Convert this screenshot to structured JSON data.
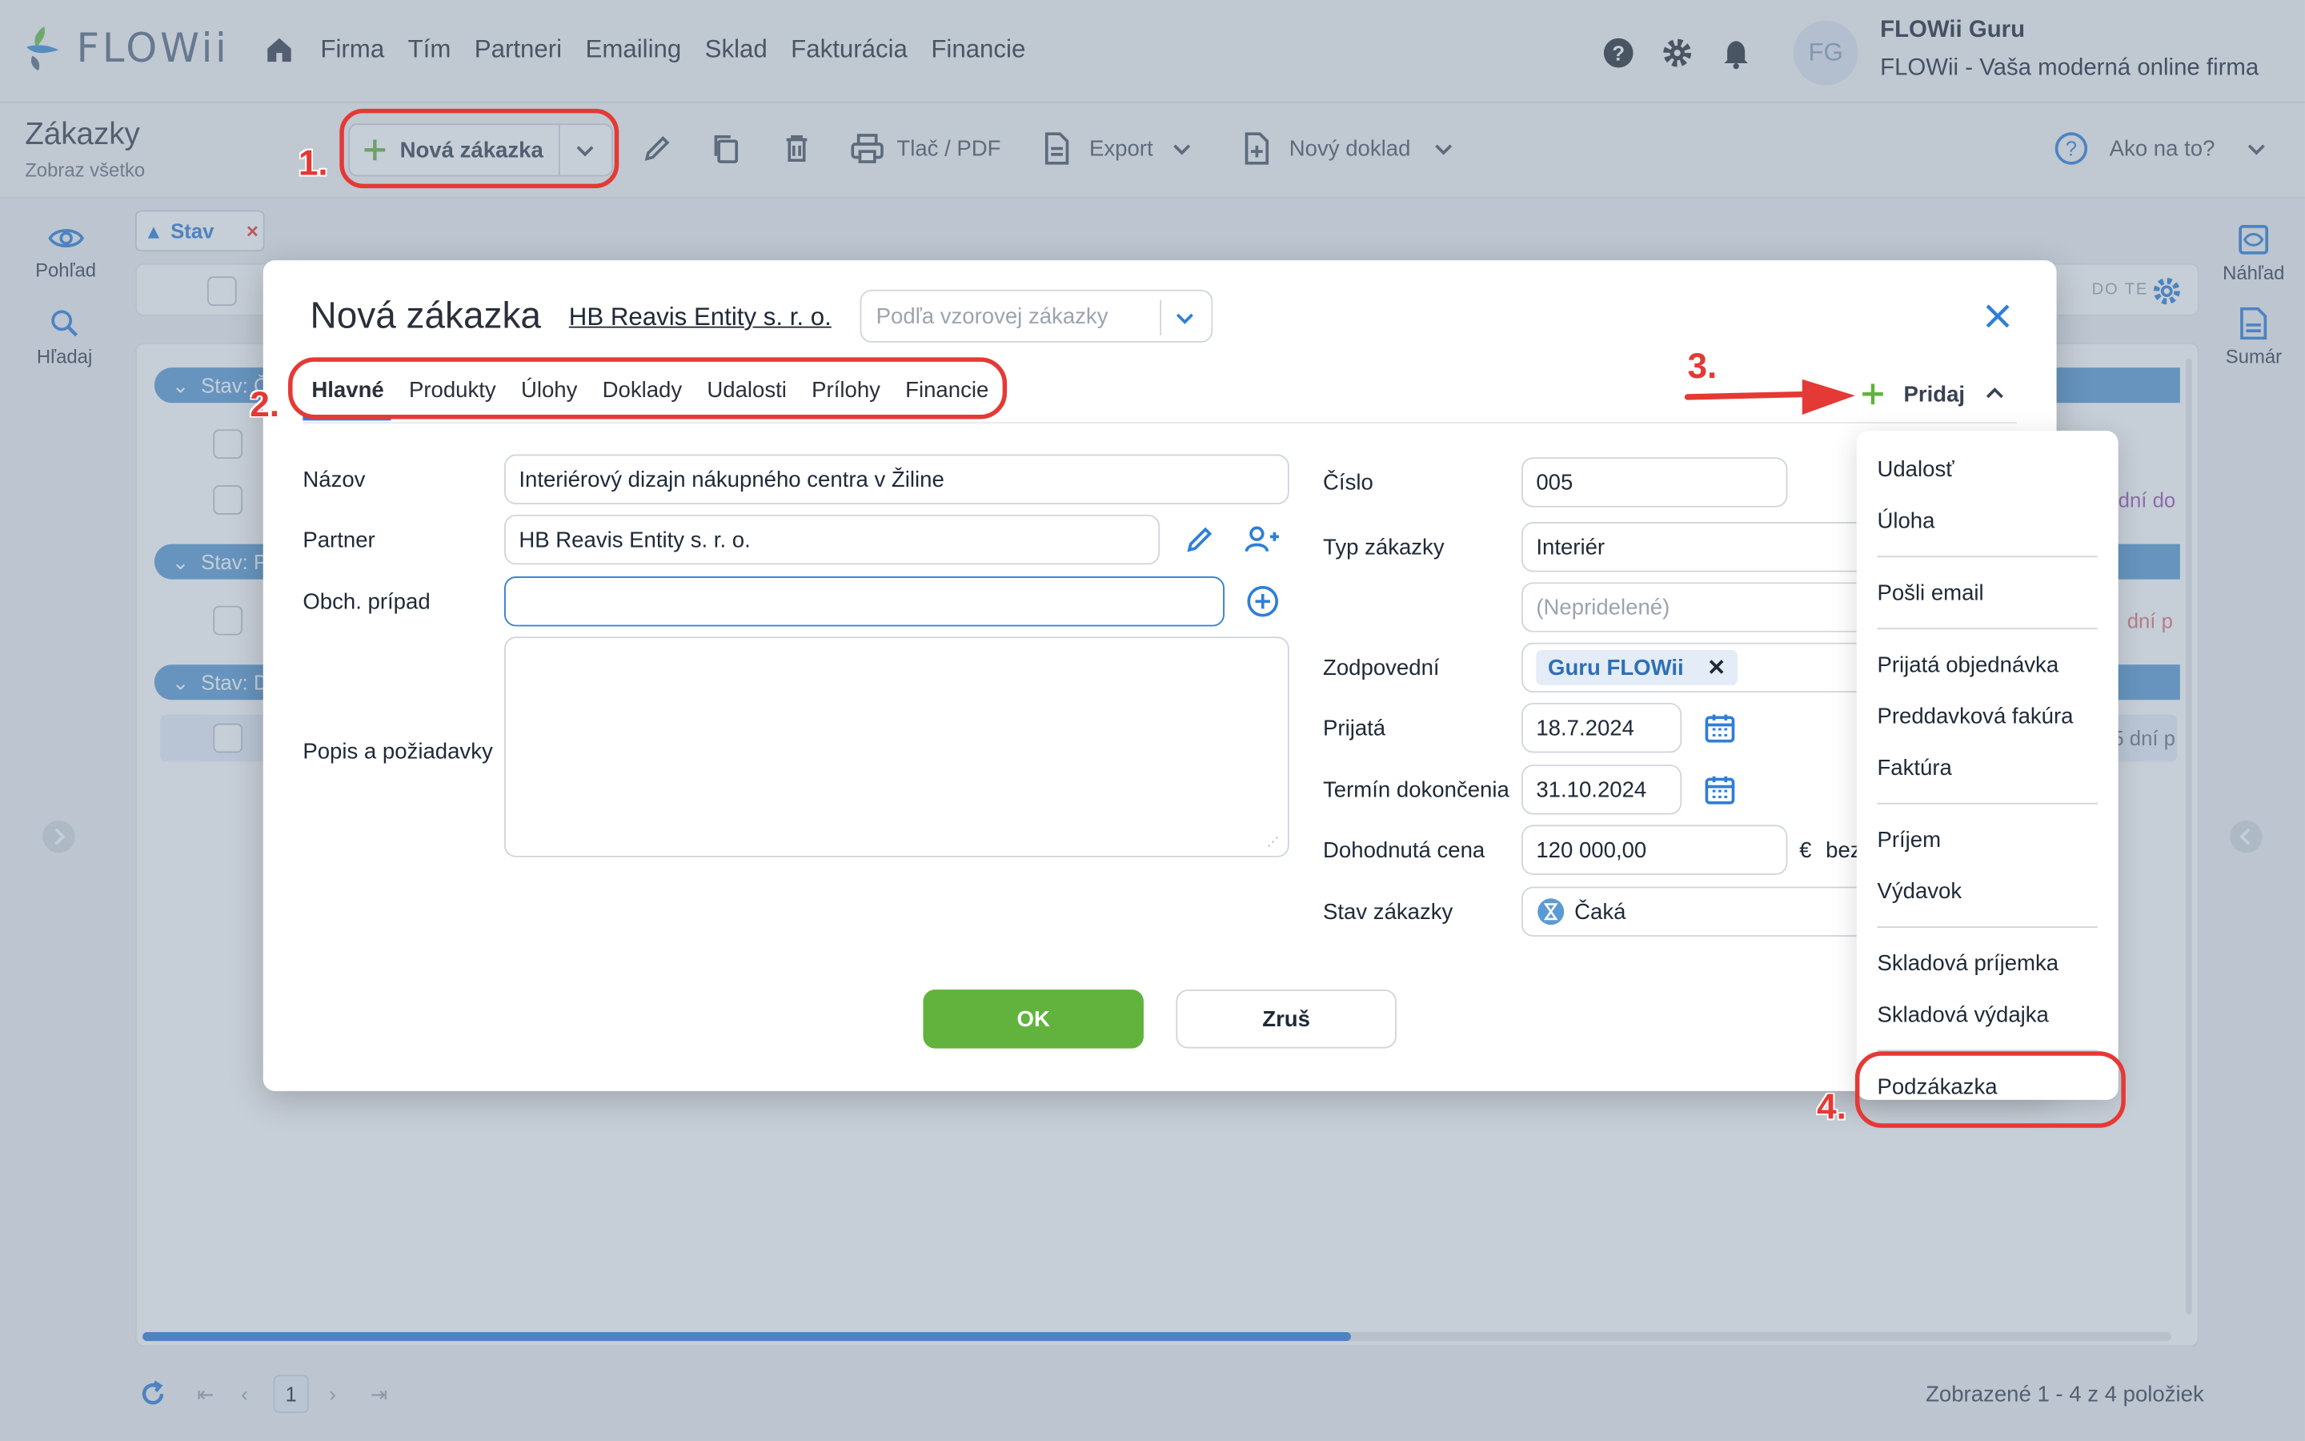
{
  "app": {
    "logo": "FLOWii",
    "nav": [
      "Firma",
      "Tím",
      "Partneri",
      "Emailing",
      "Sklad",
      "Fakturácia",
      "Financie"
    ]
  },
  "user": {
    "initials": "FG",
    "name": "FLOWii Guru",
    "company": "FLOWii - Vaša moderná online firma"
  },
  "page": {
    "title": "Zákazky",
    "subtitle": "Zobraz všetko"
  },
  "toolbar": {
    "new_label": "Nová zákazka",
    "print_label": "Tlač / PDF",
    "export_label": "Export",
    "new_doc_label": "Nový doklad",
    "help_label": "Ako na to?"
  },
  "left_rail": {
    "view": "Pohľad",
    "search": "Hľadaj"
  },
  "right_rail": {
    "preview": "Náhľad",
    "summary": "Sumár"
  },
  "list": {
    "filter_label": "Stav",
    "filter_remove": "×",
    "col_right": "DO TE",
    "groups": [
      "Stav: Č",
      "Stav: P",
      "Stav: D"
    ],
    "snippets": [
      "dní do",
      "dní p",
      "5 dní p"
    ]
  },
  "modal": {
    "title": "Nová zákazka",
    "partner_link": "HB Reavis Entity s. r. o.",
    "template_placeholder": "Podľa vzorovej zákazky",
    "tabs": [
      "Hlavné",
      "Produkty",
      "Úlohy",
      "Doklady",
      "Udalosti",
      "Prílohy",
      "Financie"
    ],
    "add_label": "Pridaj",
    "fields": {
      "name_label": "Názov",
      "name_value": "Interiérový dizajn nákupného centra v Žiline",
      "partner_label": "Partner",
      "partner_value": "HB Reavis Entity s. r. o.",
      "case_label": "Obch. prípad",
      "case_value": "",
      "desc_label": "Popis a požiadavky",
      "number_label": "Číslo",
      "number_value": "005",
      "type_label": "Typ zákazky",
      "type_value": "Interiér",
      "unassigned_placeholder": "(Nepridelené)",
      "responsible_label": "Zodpovední",
      "responsible_value": "Guru FLOWii",
      "received_label": "Prijatá",
      "received_value": "18.7.2024",
      "due_label": "Termín dokončenia",
      "due_value": "31.10.2024",
      "price_label": "Dohodnutá cena",
      "price_value": "120 000,00",
      "currency": "€",
      "price_suffix": "bez",
      "state_label": "Stav zákazky",
      "state_value": "Čaká"
    },
    "ok_label": "OK",
    "cancel_label": "Zruš"
  },
  "add_menu": {
    "items": [
      "Udalosť",
      "Úloha",
      "Pošli email",
      "Prijatá objednávka",
      "Preddavková fakúra",
      "Faktúra",
      "Príjem",
      "Výdavok",
      "Skladová príjemka",
      "Skladová výdajka",
      "Podzákazka"
    ]
  },
  "annotations": [
    "1.",
    "2.",
    "3.",
    "4."
  ],
  "pagination": {
    "page": "1",
    "summary": "Zobrazené 1 - 4 z 4 položiek"
  },
  "colors": {
    "accent": "#2f7ed8",
    "ok": "#62b33d",
    "annotation": "#e53935",
    "group": "#5b9bd5"
  }
}
